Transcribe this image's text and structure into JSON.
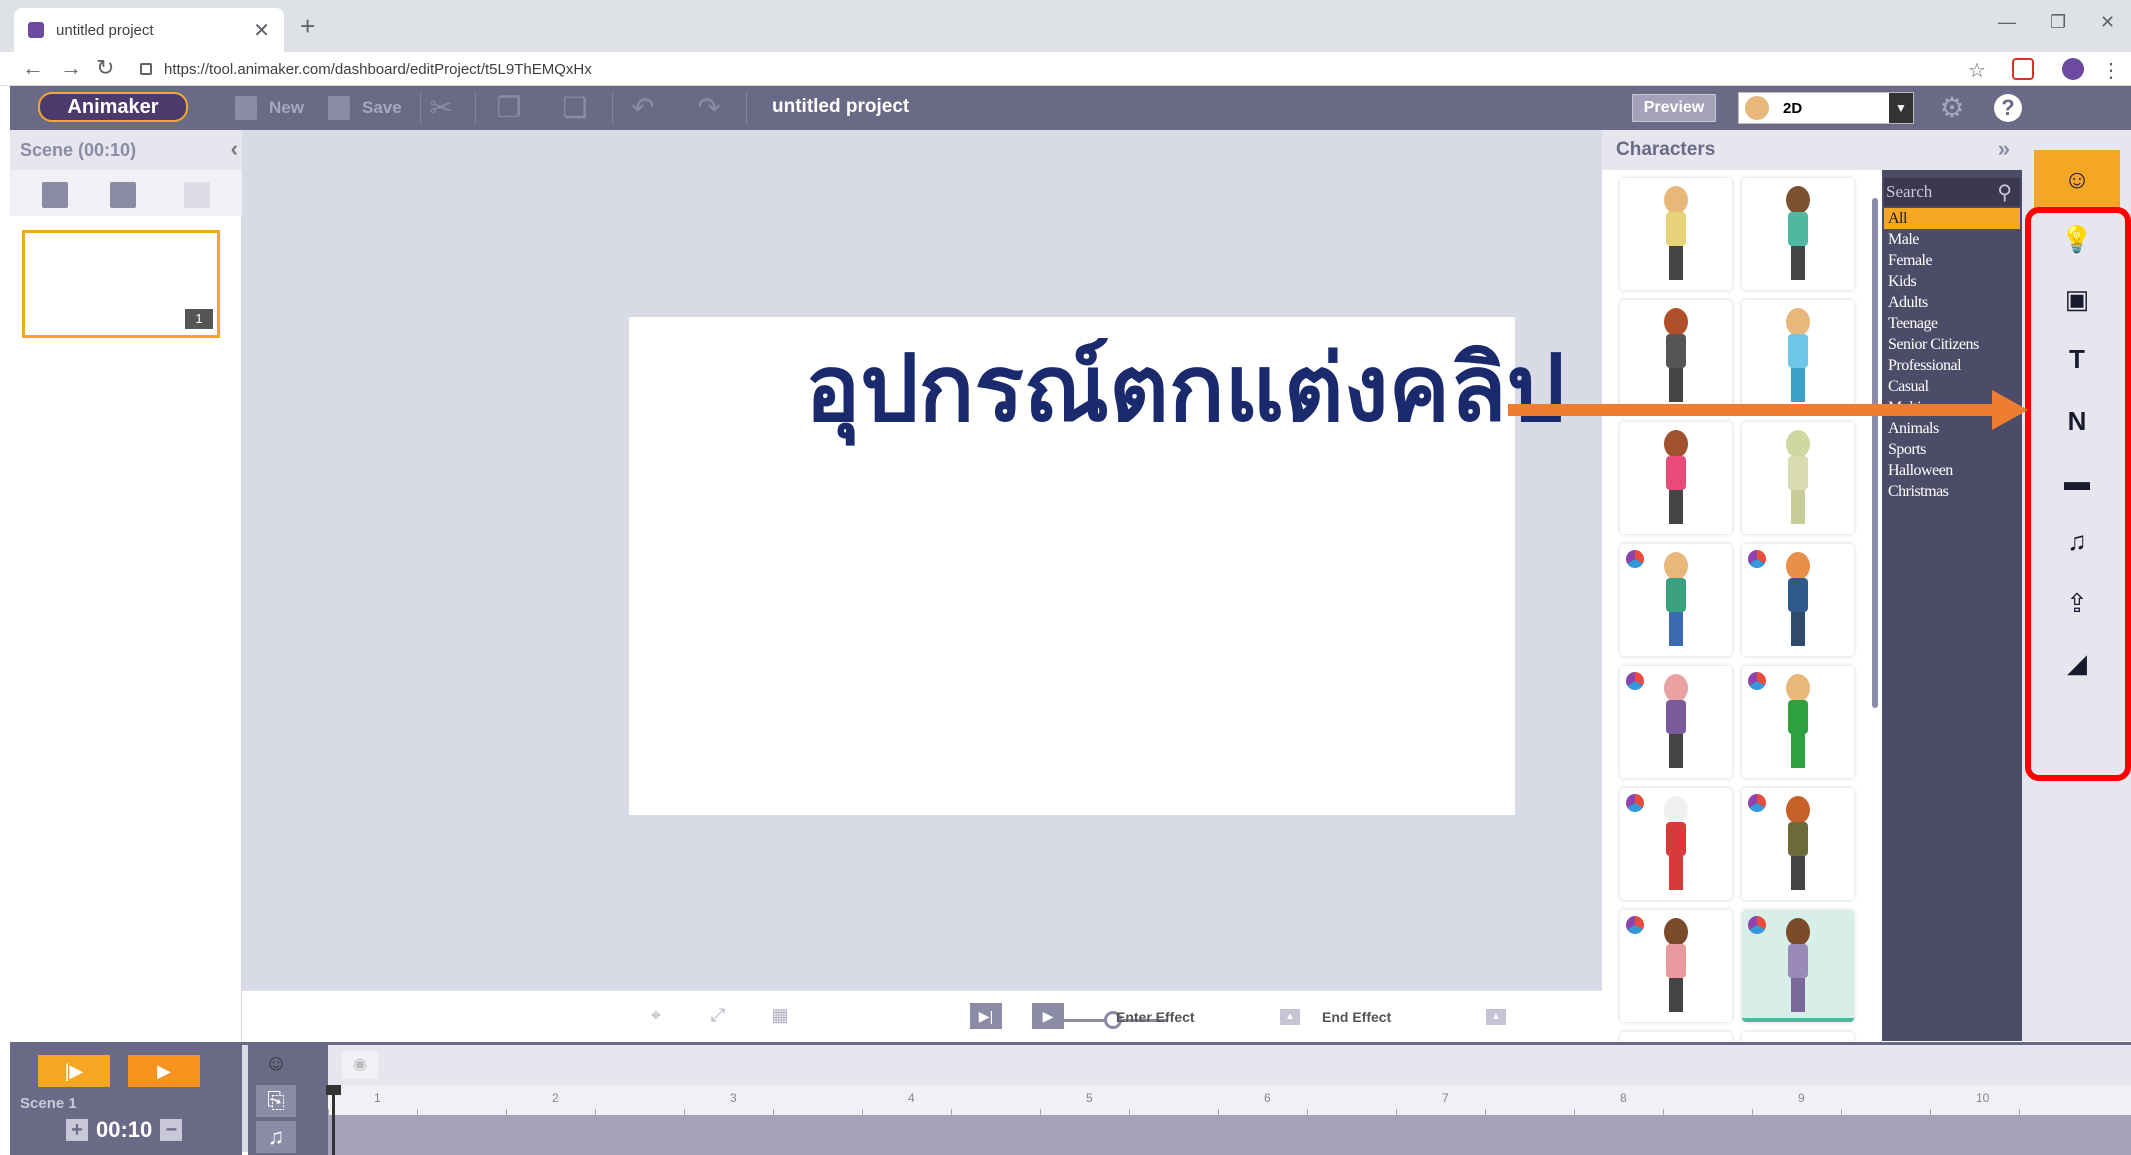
{
  "browser": {
    "tab_title": "untitled project",
    "tab_close": "✕",
    "new_tab": "+",
    "url": "https://tool.animaker.com/dashboard/editProject/t5L9ThEMQxHx"
  },
  "toolbar": {
    "logo": "Animaker",
    "new_label": "New",
    "save_label": "Save",
    "project_title": "untitled project",
    "preview_label": "Preview",
    "mode_value": "2D"
  },
  "scene_panel": {
    "title": "Scene  (00:10)",
    "thumbnail_number": "1"
  },
  "overlay": {
    "annotation_text": "อุปกรณ์ตกแต่งคลิป"
  },
  "stage_footer": {
    "enter_effect": "Enter Effect",
    "end_effect": "End Effect"
  },
  "characters": {
    "title": "Characters",
    "search_placeholder": "Search",
    "categories": [
      "All",
      "Male",
      "Female",
      "Kids",
      "Adults",
      "Teenage",
      "Senior Citizens",
      "Professional",
      "Casual",
      "Multi...",
      "Animals",
      "Sports",
      "Halloween",
      "Christmas"
    ],
    "active_category": "All"
  },
  "right_toolbar": {
    "icons": [
      "character-icon",
      "props-icon",
      "image-icon",
      "text-icon",
      "number-icon",
      "background-icon",
      "music-icon",
      "upload-icon",
      "transition-icon"
    ],
    "active": "character-icon"
  },
  "timeline": {
    "scene_label": "Scene 1",
    "duration": "00:10",
    "ruler_ticks": [
      "1",
      "2",
      "3",
      "4",
      "5",
      "6",
      "7",
      "8",
      "9",
      "10"
    ]
  },
  "colors": {
    "accent": "#f5a623",
    "toolbar_bg": "#6b6a86",
    "annotation_arrow": "#ed7d31",
    "annotation_text": "#1a2a6c",
    "highlight_box": "#ff0000"
  }
}
